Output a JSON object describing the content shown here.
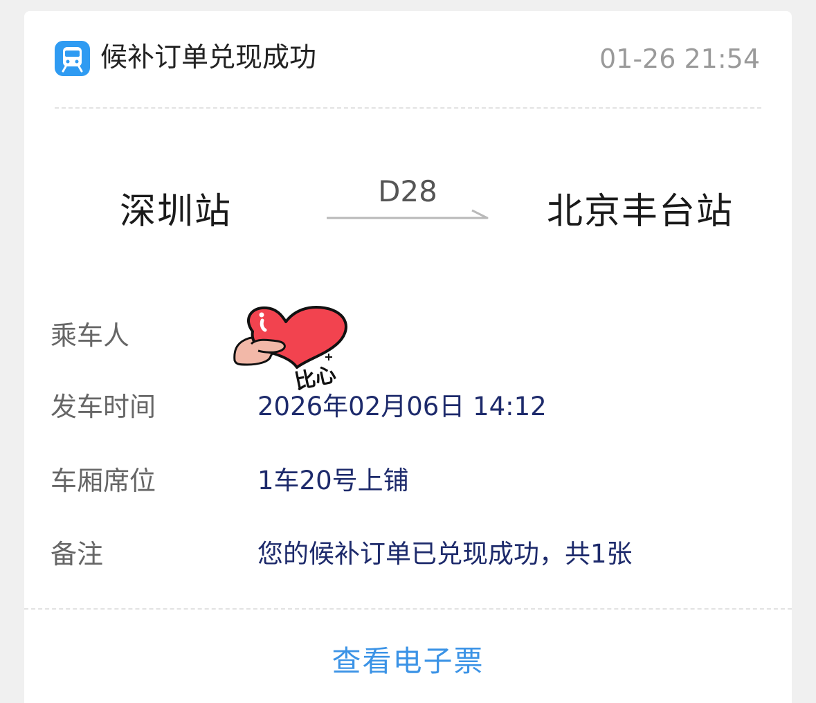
{
  "header": {
    "app_icon": "train-icon",
    "title": "候补订单兑现成功",
    "timestamp": "01-26 21:54"
  },
  "route": {
    "from_station": "深圳站",
    "train_number": "D28",
    "to_station": "北京丰台站"
  },
  "details": {
    "passenger": {
      "label": "乘车人",
      "value": "",
      "sticker_text": "比心",
      "sticker_icon": "heart-hand-sticker"
    },
    "departure": {
      "label": "发车时间",
      "value": "2026年02月06日 14:12"
    },
    "seat": {
      "label": "车厢席位",
      "value": "1车20号上铺"
    },
    "remark": {
      "label": "备注",
      "value": "您的候补订单已兑现成功，共1张"
    }
  },
  "actions": {
    "view_ticket": "查看电子票"
  },
  "colors": {
    "accent": "#3b93e6",
    "value_text": "#1d2a6b",
    "icon_bg": "#2f9bf2"
  }
}
